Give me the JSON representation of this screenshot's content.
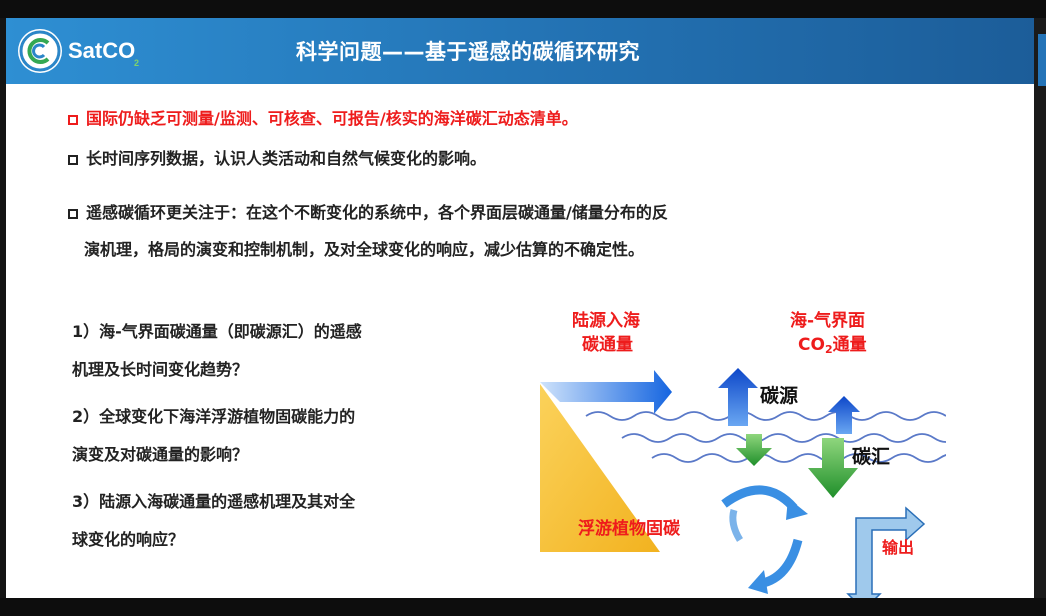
{
  "header": {
    "logo_text": "SatCO",
    "logo_sub": "2",
    "title": "科学问题——基于遥感的碳循环研究"
  },
  "bullets": [
    {
      "text": "国际仍缺乏可测量/监测、可核查、可报告/核实的海洋碳汇动态清单。",
      "color": "#ee1c1c"
    },
    {
      "text": "长时间序列数据，认识人类活动和自然气候变化的影响。",
      "color": "#222222"
    },
    {
      "text": "遥感碳循环更关注于：在这个不断变化的系统中，各个界面层碳通量/储量分布的反",
      "color": "#222222"
    },
    {
      "text": "演机理，格局的演变和控制机制，及对全球变化的响应，减少估算的不确定性。",
      "color": "#222222"
    }
  ],
  "questions": [
    "1）海-气界面碳通量（即碳源汇）的遥感",
    "机理及长时间变化趋势？",
    "2）全球变化下海洋浮游植物固碳能力的",
    "演变及对碳通量的影响？",
    "3）陆源入海碳通量的遥感机理及其对全",
    "球变化的响应？"
  ],
  "diagram": {
    "land_label_1": "陆源入海",
    "land_label_2": "碳通量",
    "air_sea_label_1": "海-气界面",
    "air_sea_label_2a": "CO",
    "air_sea_label_2sub": "2",
    "air_sea_label_2b": "通量",
    "source_label": "碳源",
    "sink_label": "碳汇",
    "phyto_label": "浮游植物固碳",
    "export_label": "输出"
  },
  "colors": {
    "header_blue": "#2372b3",
    "red": "#ee1c1c",
    "arrow_blue": "#1565e0",
    "arrow_green": "#27a033",
    "wedge_yellow": "#f7c33a"
  }
}
